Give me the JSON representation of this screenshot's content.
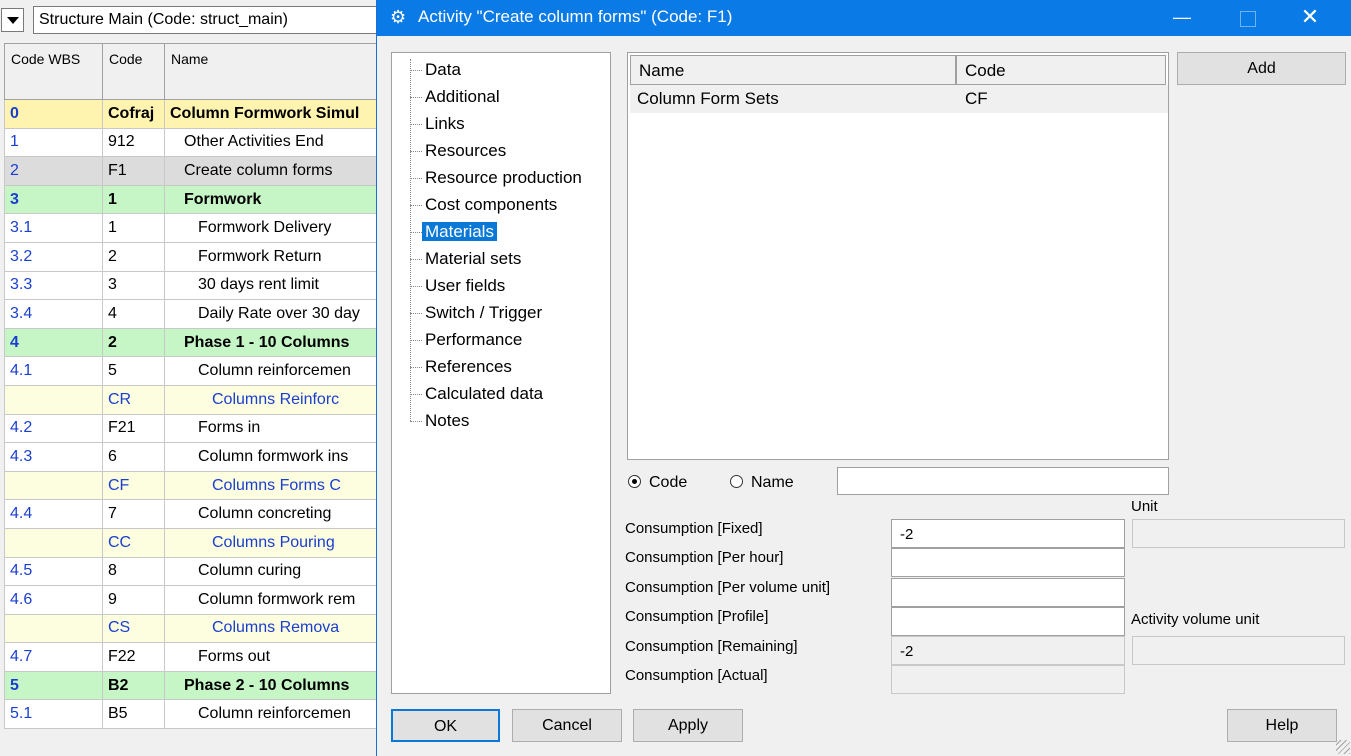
{
  "main_window": {
    "structure_combo": "Structure Main (Code: struct_main)",
    "columns": [
      "Code WBS",
      "Code",
      "Name"
    ],
    "rows": [
      {
        "wbs": "0",
        "code": "Cofraj",
        "name": "Column Formwork Simul",
        "style": "lvl1"
      },
      {
        "wbs": "1",
        "code": "912",
        "name": "Other Activities End",
        "style": "norm",
        "indent": 1
      },
      {
        "wbs": "2",
        "code": "F1",
        "name": "Create column forms",
        "style": "sel",
        "indent": 1
      },
      {
        "wbs": "3",
        "code": "1",
        "name": "Formwork",
        "style": "lvl2",
        "indent": 1
      },
      {
        "wbs": "3.1",
        "code": "1",
        "name": "Formwork Delivery",
        "style": "norm",
        "indent": 2
      },
      {
        "wbs": "3.2",
        "code": "2",
        "name": "Formwork Return",
        "style": "norm",
        "indent": 2
      },
      {
        "wbs": "3.3",
        "code": "3",
        "name": "30 days rent limit",
        "style": "norm",
        "indent": 2
      },
      {
        "wbs": "3.4",
        "code": "4",
        "name": "Daily Rate over 30 day",
        "style": "norm",
        "indent": 2
      },
      {
        "wbs": "4",
        "code": "2",
        "name": "Phase 1 - 10 Columns",
        "style": "lvl2",
        "indent": 1
      },
      {
        "wbs": "4.1",
        "code": "5",
        "name": "Column reinforcemen",
        "style": "norm",
        "indent": 2
      },
      {
        "wbs": "",
        "code": "CR",
        "name": "Columns Reinforc",
        "style": "mat",
        "indent": 3
      },
      {
        "wbs": "4.2",
        "code": "F21",
        "name": "Forms in",
        "style": "norm",
        "indent": 2
      },
      {
        "wbs": "4.3",
        "code": "6",
        "name": "Column formwork ins",
        "style": "norm",
        "indent": 2
      },
      {
        "wbs": "",
        "code": "CF",
        "name": "Columns Forms C",
        "style": "mat",
        "indent": 3
      },
      {
        "wbs": "4.4",
        "code": "7",
        "name": "Column concreting",
        "style": "norm",
        "indent": 2
      },
      {
        "wbs": "",
        "code": "CC",
        "name": "Columns Pouring",
        "style": "mat",
        "indent": 3
      },
      {
        "wbs": "4.5",
        "code": "8",
        "name": "Column curing",
        "style": "norm",
        "indent": 2
      },
      {
        "wbs": "4.6",
        "code": "9",
        "name": "Column formwork rem",
        "style": "norm",
        "indent": 2
      },
      {
        "wbs": "",
        "code": "CS",
        "name": "Columns Remova",
        "style": "mat",
        "indent": 3
      },
      {
        "wbs": "4.7",
        "code": "F22",
        "name": "Forms out",
        "style": "norm",
        "indent": 2
      },
      {
        "wbs": "5",
        "code": "B2",
        "name": "Phase 2 - 10 Columns",
        "style": "lvl2",
        "indent": 1
      },
      {
        "wbs": "5.1",
        "code": "B5",
        "name": "Column reinforcemen",
        "style": "norm",
        "indent": 2
      }
    ]
  },
  "dialog": {
    "title": "Activity \"Create column forms\" (Code: F1)",
    "icons": {
      "app": "gear-icon",
      "minimize": "minimize-icon",
      "maximize": "maximize-icon",
      "close": "close-icon"
    },
    "tree": [
      "Data",
      "Additional",
      "Links",
      "Resources",
      "Resource production",
      "Cost components",
      "Materials",
      "Material sets",
      "User fields",
      "Switch / Trigger",
      "Performance",
      "References",
      "Calculated data",
      "Notes"
    ],
    "tree_selected": "Materials",
    "list": {
      "col_name": "Name",
      "col_code": "Code",
      "rows": [
        {
          "name": "Column Form Sets",
          "code": "CF"
        }
      ]
    },
    "add_button": "Add",
    "search": {
      "radio_code": "Code",
      "radio_name": "Name",
      "selected": "Code",
      "value": ""
    },
    "unit_label": "Unit",
    "activity_volume_unit_label": "Activity volume unit",
    "consumption": {
      "fixed_label": "Consumption [Fixed]",
      "fixed": "-2",
      "per_hour_label": "Consumption [Per hour]",
      "per_hour": "",
      "per_volume_label": "Consumption [Per volume unit]",
      "per_volume": "",
      "profile_label": "Consumption [Profile]",
      "profile": "",
      "remaining_label": "Consumption [Remaining]",
      "remaining": "-2",
      "actual_label": "Consumption [Actual]",
      "actual": ""
    },
    "buttons": {
      "ok": "OK",
      "cancel": "Cancel",
      "apply": "Apply",
      "help": "Help"
    }
  }
}
